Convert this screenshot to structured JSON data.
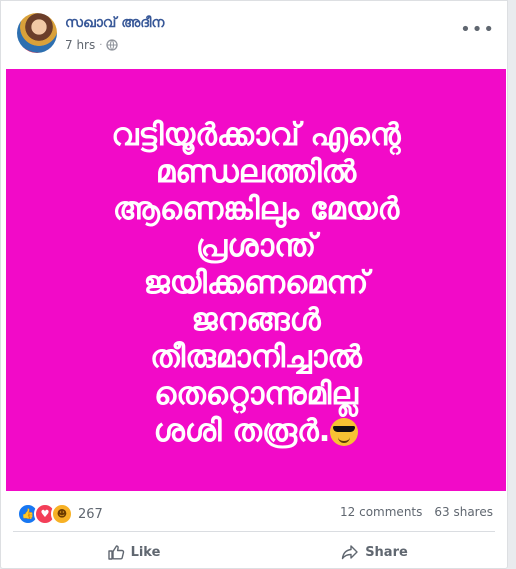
{
  "post": {
    "author": "സഖാവ് അദീന",
    "time": "7 hrs",
    "text_lines": [
      "വട്ടിയൂർക്കാവ് എന്റെ",
      "മണ്ഡലത്തിൽ",
      "ആണെങ്കിലും മേയർ",
      "പ്രശാന്ത്",
      "ജയിക്കണമെന്ന്",
      "ജനങ്ങൾ",
      "തീരുമാനിച്ചാൽ",
      "തെറ്റൊന്നുമില്ല",
      "ശശി തരൂർ."
    ],
    "background_color": "#f20ac8"
  },
  "stats": {
    "reaction_count": "267",
    "comments": "12 comments",
    "shares": "63 shares",
    "reactions": [
      "like-icon",
      "love-icon",
      "haha-icon"
    ]
  },
  "actions": {
    "like_label": "Like",
    "share_label": "Share"
  },
  "colors": {
    "author": "#385898",
    "post_background": "#f20ac8"
  }
}
